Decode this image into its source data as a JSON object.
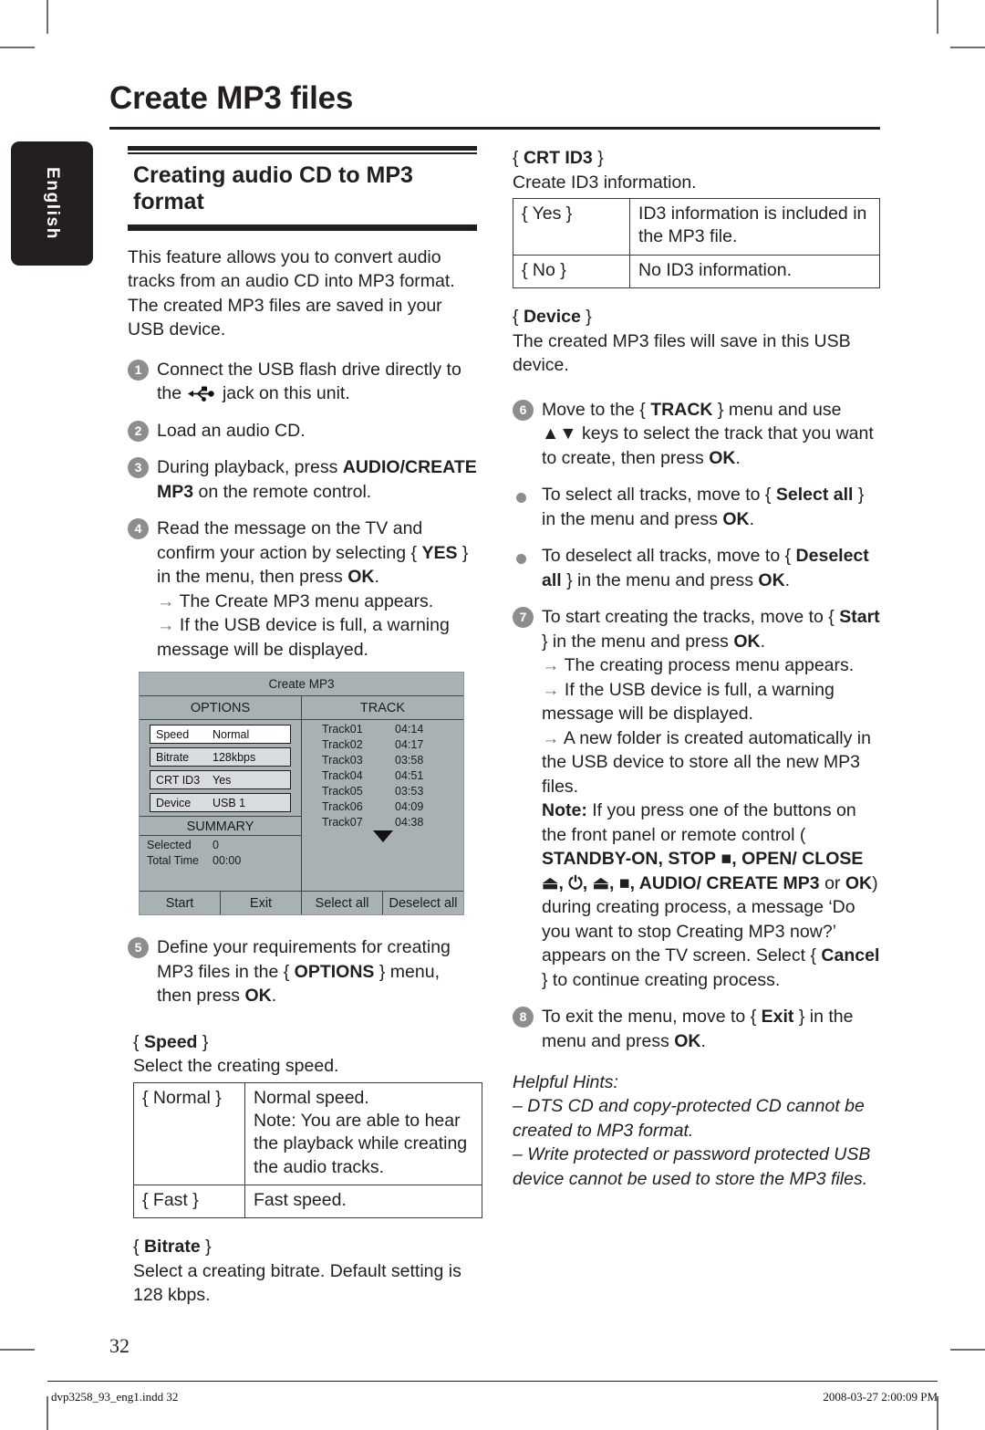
{
  "page": {
    "title": "Create MP3 files",
    "language_tab": "English",
    "page_number": "32",
    "footer_left": "dvp3258_93_eng1.indd   32",
    "footer_right": "2008-03-27   2:00:09 PM"
  },
  "left_column": {
    "section_heading": "Creating audio CD to MP3 format",
    "intro": "This feature allows you to convert audio tracks from an audio CD into MP3 format. The created MP3 files are saved in your USB device.",
    "step1_a": "Connect the USB flash drive directly to the ",
    "step1_b": " jack on this unit.",
    "step1_num": "1",
    "step2": "Load an audio CD.",
    "step2_num": "2",
    "step3_num": "3",
    "step3_a": "During playback, press ",
    "step3_bold1": "AUDIO/",
    "step3_bold2": "CREATE MP3",
    "step3_b": " on the remote control.",
    "step4_num": "4",
    "step4_a": "Read the message on the TV and confirm your action by selecting { ",
    "step4_bold1": "YES",
    "step4_b": " } in the menu, then press ",
    "step4_bold2": "OK",
    "step4_c": ".",
    "step4_arrow1": "The Create MP3 menu appears.",
    "step4_arrow2": "If the USB device is full, a warning message will be displayed.",
    "step5_num": "5",
    "step5_a": "Define your requirements for creating MP3 files in the { ",
    "step5_bold1": "OPTIONS",
    "step5_b": " } menu, then press ",
    "step5_bold2": "OK",
    "step5_c": ".",
    "speed_head_open": "{ ",
    "speed_head_bold": "Speed",
    "speed_head_close": " }",
    "speed_desc": "Select the creating speed.",
    "speed_table": [
      {
        "key": "{ Normal }",
        "value": "Normal speed.\nNote:  You are able to hear the playback while creating the audio tracks."
      },
      {
        "key": "{ Fast }",
        "value": "Fast speed."
      }
    ],
    "bitrate_head_open": "{ ",
    "bitrate_head_bold": "Bitrate",
    "bitrate_head_close": " }",
    "bitrate_desc": "Select a creating bitrate.  Default setting is 128 kbps."
  },
  "right_column": {
    "crtid3_head_open": "{ ",
    "crtid3_head_bold": "CRT ID3",
    "crtid3_head_close": " }",
    "crtid3_desc": "Create ID3 information.",
    "crtid3_table": [
      {
        "key": "{ Yes }",
        "value": "ID3 information is included in the MP3 file."
      },
      {
        "key": "{ No }",
        "value": "No ID3 information."
      }
    ],
    "device_head_open": "{ ",
    "device_head_bold": "Device",
    "device_head_close": " }",
    "device_desc": "The created MP3 files will save in this USB device.",
    "step6_num": "6",
    "step6_a": "Move to the { ",
    "step6_bold1": "TRACK",
    "step6_b": " } menu and use ",
    "step6_keys": "▲▼",
    "step6_c": " keys to select the track that you want to create, then press ",
    "step6_bold2": "OK",
    "step6_d": ".",
    "bullet1_a": "To select all tracks, move to { ",
    "bullet1_bold1": "Select all",
    "bullet1_b": " } in the menu and press ",
    "bullet1_bold2": "OK",
    "bullet1_c": ".",
    "bullet2_a": "To deselect all tracks, move to { ",
    "bullet2_bold1": "Deselect all",
    "bullet2_b": " } in the menu and press ",
    "bullet2_bold2": "OK",
    "bullet2_c": ".",
    "step7_num": "7",
    "step7_a": "To start creating the tracks, move to { ",
    "step7_bold1": "Start",
    "step7_b": " } in the menu and press ",
    "step7_bold2": "OK",
    "step7_c": ".",
    "step7_arrow1": "The creating process menu appears.",
    "step7_arrow2": "If the USB device is full, a warning message will be displayed.",
    "step7_arrow3": "A new folder is created automatically in the USB device to store all the new MP3 files.",
    "note_label": "Note:",
    "note_a": " If you press one of the buttons on the front panel or remote control ( ",
    "note_bold1": "STANDBY-ON",
    "note_sep1": ", ",
    "note_bold2": "STOP",
    "note_icon1": "■",
    "note_sep2": ", ",
    "note_bold3": "OPEN/ CLOSE",
    "note_icon2": "⏏",
    "note_sep3": ",  ",
    "note_icon3": "⏻",
    "note_sep4": ", ",
    "note_icon4": "⏏",
    "note_sep5": ", ",
    "note_icon5": "■",
    "note_sep6": ", ",
    "note_bold4": "AUDIO/ CREATE MP3",
    "note_or": " or ",
    "note_bold5": "OK",
    "note_b": ") during creating process, a message ‘Do you want to stop Creating MP3 now?’ appears on the TV screen. Select { ",
    "note_bold6": "Cancel",
    "note_c": " } to continue creating process.",
    "step8_num": "8",
    "step8_a": "To exit the menu, move to { ",
    "step8_bold1": "Exit",
    "step8_b": " } in the menu and press ",
    "step8_bold2": "OK",
    "step8_c": ".",
    "hints_title": "Helpful Hints:",
    "hint1": "–   DTS CD and copy-protected CD cannot be created to MP3 format.",
    "hint2": "–   Write protected or password protected USB device cannot be used to store the MP3 files."
  },
  "tv_screen": {
    "title": "Create MP3",
    "options_header": "OPTIONS",
    "track_header": "TRACK",
    "summary_header": "SUMMARY",
    "options": [
      {
        "key": "Speed",
        "value": "Normal",
        "selected": true
      },
      {
        "key": "Bitrate",
        "value": "128kbps",
        "selected": false
      },
      {
        "key": "CRT ID3",
        "value": "Yes",
        "selected": false
      },
      {
        "key": "Device",
        "value": "USB 1",
        "selected": false
      }
    ],
    "summary": [
      {
        "key": "Selected",
        "value": "0"
      },
      {
        "key": "Total Time",
        "value": "00:00"
      }
    ],
    "tracks": [
      {
        "name": "Track01",
        "time": "04:14"
      },
      {
        "name": "Track02",
        "time": "04:17"
      },
      {
        "name": "Track03",
        "time": "03:58"
      },
      {
        "name": "Track04",
        "time": "04:51"
      },
      {
        "name": "Track05",
        "time": "03:53"
      },
      {
        "name": "Track06",
        "time": "04:09"
      },
      {
        "name": "Track07",
        "time": "04:38"
      }
    ],
    "buttons": [
      "Start",
      "Exit",
      "Select all",
      "Deselect all"
    ]
  },
  "colors": {
    "ink": "#231f20",
    "step_badge": "#8d8d8d",
    "tv_bg": "#a8b2b4",
    "tv_row": "#d8dcdc",
    "tv_row_selected": "#ffffff"
  }
}
